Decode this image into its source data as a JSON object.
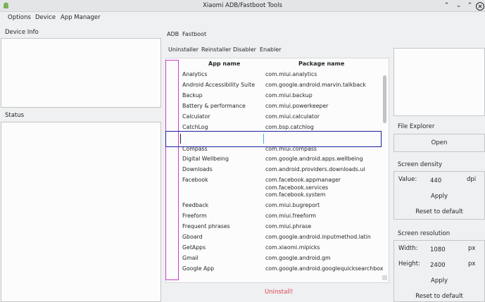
{
  "window": {
    "title": "Xiaomi ADB/Fastboot Tools"
  },
  "menu": {
    "options": "Options",
    "device": "Device",
    "app_manager": "App Manager"
  },
  "left": {
    "device_info": "Device Info",
    "status": "Status"
  },
  "mode_tabs": {
    "adb": "ADB",
    "fastboot": "Fastboot"
  },
  "sub_tabs": {
    "uninstaller": "Uninstaller",
    "reinstaller": "Reinstaller",
    "disabler": "Disabler",
    "enabler": "Enabler"
  },
  "table": {
    "col_app": "App name",
    "col_pkg": "Package name",
    "rows": [
      {
        "app": "Analytics",
        "pkg": "com.miui.analytics"
      },
      {
        "app": "Android Accessibility Suite",
        "pkg": "com.google.android.marvin.talkback"
      },
      {
        "app": "Backup",
        "pkg": "com.miui.backup"
      },
      {
        "app": "Battery & performance",
        "pkg": "com.miui.powerkeeper"
      },
      {
        "app": "Calculator",
        "pkg": "com.miui.calculator"
      },
      {
        "app": "CatchLog",
        "pkg": "com.bsp.catchlog"
      },
      {
        "app": "Compass",
        "pkg": "com.miui.compass"
      },
      {
        "app": "Digital Wellbeing",
        "pkg": "com.google.android.apps.wellbeing"
      },
      {
        "app": "Downloads",
        "pkg": "com.android.providers.downloads.ui"
      },
      {
        "app": "Facebook",
        "pkg": "com.facebook.appmanager",
        "pkg2": "com.facebook.services",
        "pkg3": "com.facebook.system"
      },
      {
        "app": "Feedback",
        "pkg": "com.miui.bugreport"
      },
      {
        "app": "Freeform",
        "pkg": "com.miui.freeform"
      },
      {
        "app": "Frequent phrases",
        "pkg": "com.miui.phrase"
      },
      {
        "app": "Gboard",
        "pkg": "com.google.android.inputmethod.latin"
      },
      {
        "app": "GetApps",
        "pkg": "com.xiaomi.mipicks"
      },
      {
        "app": "Gmail",
        "pkg": "com.google.android.gm"
      },
      {
        "app": "Google App",
        "pkg": "com.google.android.googlequicksearchbox"
      }
    ]
  },
  "uninstall_label": "Uninstall!",
  "file_explorer": {
    "title": "File Explorer",
    "open": "Open"
  },
  "density": {
    "title": "Screen density",
    "value_label": "Value:",
    "value": "440",
    "unit": "dpi",
    "apply": "Apply",
    "reset": "Reset to default"
  },
  "resolution": {
    "title": "Screen resolution",
    "width_label": "Width:",
    "width": "1080",
    "height_label": "Height:",
    "height": "2400",
    "unit": "px",
    "apply": "Apply",
    "reset": "Reset to default"
  },
  "icons": {
    "app": "android-icon",
    "window_buttons": [
      "shade-icon",
      "minimize-icon",
      "maximize-icon",
      "close-icon"
    ]
  },
  "colors": {
    "highlight_magenta": "#c83cd0",
    "highlight_blue": "#1b1f9e",
    "uninstall": "#da4453"
  }
}
